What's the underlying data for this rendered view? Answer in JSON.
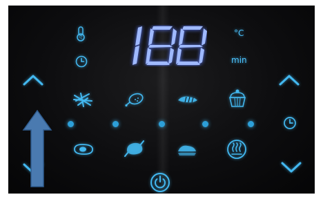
{
  "display": {
    "digits": [
      "1",
      "8",
      "8"
    ],
    "unit_temp": "°C",
    "unit_time": "min"
  },
  "colors": {
    "accent": "#43b8f0",
    "panel": "#0d0d0f",
    "overlay_arrow": "#4a7ab0"
  },
  "icons": {
    "left": [
      "temperature-icon",
      "timer-icon",
      "temp-up-chevron-icon",
      "temp-down-chevron-icon"
    ],
    "presets_top": [
      "fries-icon",
      "drumstick-icon",
      "shrimp-icon",
      "cake-icon"
    ],
    "presets_bottom": [
      "steak-icon",
      "chicken-icon",
      "fish-icon",
      "keep-warm-icon"
    ],
    "right": [
      "time-up-chevron-icon",
      "clock-icon",
      "time-down-chevron-icon"
    ],
    "bottom": [
      "power-icon"
    ]
  }
}
